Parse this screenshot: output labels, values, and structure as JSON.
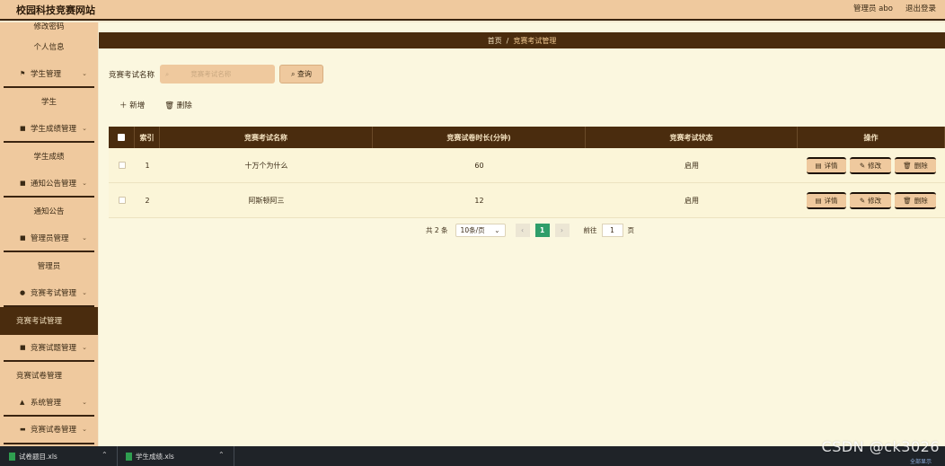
{
  "header": {
    "site_title": "校园科技竞赛网站",
    "admin_label": "管理员 abo",
    "logout_label": "退出登录"
  },
  "sidebar": {
    "items": [
      {
        "label": "修改密码",
        "kind": "sub"
      },
      {
        "label": "个人信息",
        "kind": "sub"
      },
      {
        "label": "学生管理",
        "kind": "group",
        "icon": "flag-icon"
      },
      {
        "label": "学生",
        "kind": "sub"
      },
      {
        "label": "学生成绩管理",
        "kind": "group",
        "icon": "grid-icon"
      },
      {
        "label": "学生成绩",
        "kind": "sub"
      },
      {
        "label": "通知公告管理",
        "kind": "group",
        "icon": "grid-icon"
      },
      {
        "label": "通知公告",
        "kind": "sub"
      },
      {
        "label": "管理员管理",
        "kind": "group",
        "icon": "grid-icon"
      },
      {
        "label": "管理员",
        "kind": "sub"
      },
      {
        "label": "竞赛考试管理",
        "kind": "group",
        "icon": "bulb-icon"
      },
      {
        "label": "竞赛考试管理",
        "kind": "active"
      },
      {
        "label": "竞赛试题管理",
        "kind": "group",
        "icon": "grid-icon"
      },
      {
        "label": "竞赛试卷管理",
        "kind": "plain"
      },
      {
        "label": "系统管理",
        "kind": "group",
        "icon": "user-icon"
      },
      {
        "label": "竞赛试卷管理",
        "kind": "group",
        "icon": "briefcase-icon"
      }
    ]
  },
  "breadcrumb": {
    "home": "首页",
    "separator": "/",
    "current": "竞赛考试管理"
  },
  "search": {
    "label": "竞赛考试名称",
    "placeholder": "竞赛考试名称",
    "query_button": "查询"
  },
  "actions": {
    "add_label": "新增",
    "delete_label": "删除"
  },
  "table": {
    "headers": [
      "索引",
      "竞赛考试名称",
      "竞赛试卷时长(分钟)",
      "竞赛考试状态",
      "操作"
    ],
    "rows": [
      {
        "index": "1",
        "name": "十万个为什么",
        "duration": "60",
        "status": "启用"
      },
      {
        "index": "2",
        "name": "阿斯顿阿三",
        "duration": "12",
        "status": "启用"
      }
    ],
    "row_actions": {
      "detail": "详情",
      "edit": "修改",
      "delete": "删除"
    }
  },
  "pagination": {
    "total_text": "共 2 条",
    "page_size": "10条/页",
    "current_page": "1",
    "goto_label": "前往",
    "goto_value": "1",
    "page_suffix": "页"
  },
  "taskbar": {
    "items": [
      {
        "label": "试卷题目.xls"
      },
      {
        "label": "学生成绩.xls"
      }
    ],
    "right_text": "全部显示"
  },
  "watermark": "CSDN @ck3026",
  "colors": {
    "sidebar_bg": "#efc99e",
    "accent_dark": "#4a2c0e",
    "content_bg": "#fbf7df",
    "page_active": "#2f9e6a"
  }
}
